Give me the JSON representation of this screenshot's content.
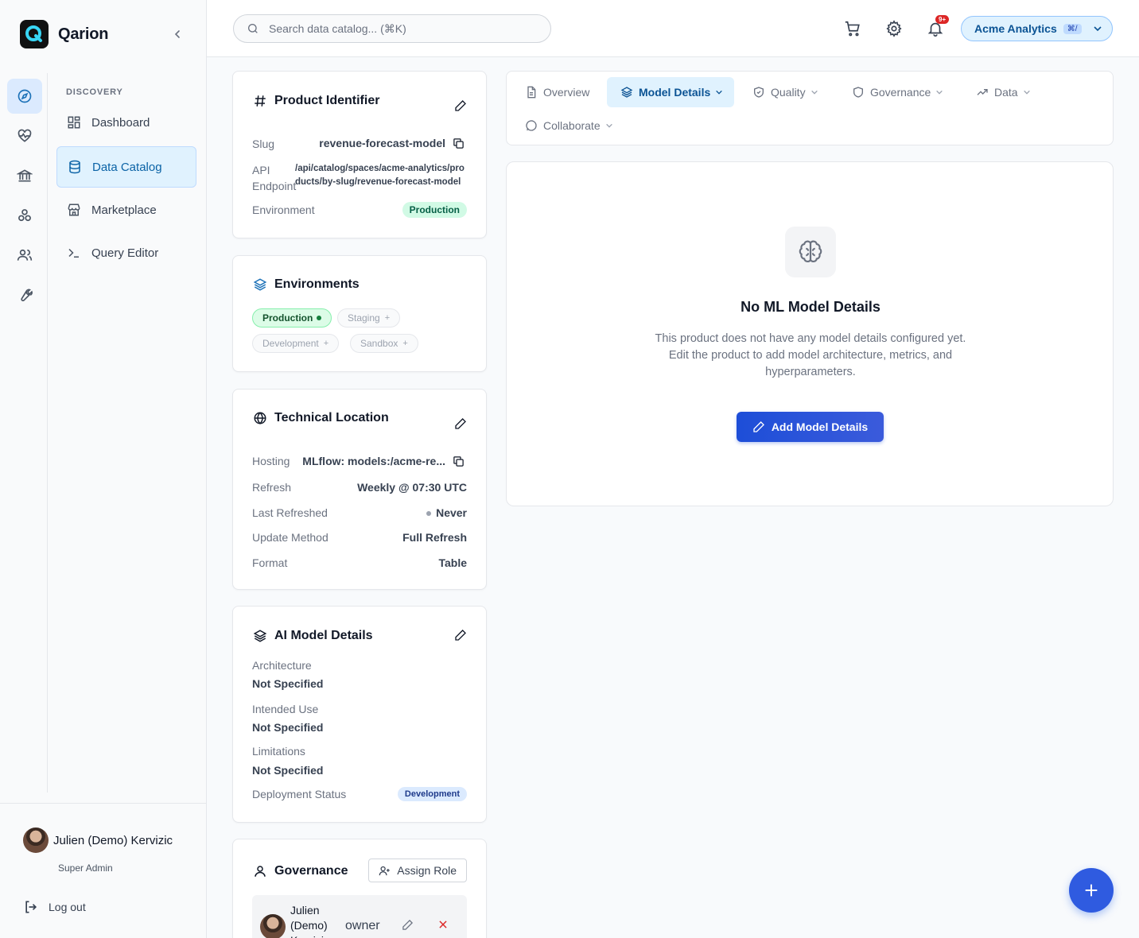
{
  "app": {
    "name": "Qarion"
  },
  "sidebar": {
    "section": "DISCOVERY",
    "rail_icons": [
      "compass-icon",
      "heartbeat-icon",
      "bank-icon",
      "network-icon",
      "users-icon",
      "wrench-icon"
    ],
    "items": [
      {
        "label": "Dashboard",
        "icon": "dashboard-icon",
        "active": false
      },
      {
        "label": "Data Catalog",
        "icon": "database-icon",
        "active": true
      },
      {
        "label": "Marketplace",
        "icon": "store-icon",
        "active": false
      },
      {
        "label": "Query Editor",
        "icon": "terminal-icon",
        "active": false
      }
    ],
    "user": {
      "name": "Julien (Demo) Kervizic",
      "role": "Super Admin"
    },
    "logout_label": "Log out"
  },
  "header": {
    "search_placeholder": "Search data catalog... (⌘K)",
    "notification_badge": "9+",
    "org": {
      "name": "Acme Analytics",
      "shortcut": "⌘/"
    }
  },
  "product_identifier": {
    "title": "Product Identifier",
    "slug_label": "Slug",
    "slug_value": "revenue-forecast-model",
    "api_label": "API Endpoint",
    "api_value": "/api/catalog/spaces/acme-analytics/products/by-slug/revenue-forecast-model",
    "env_label": "Environment",
    "env_value": "Production"
  },
  "environments": {
    "title": "Environments",
    "chips": [
      {
        "label": "Production",
        "active": true
      },
      {
        "label": "Staging",
        "active": false
      },
      {
        "label": "Development",
        "active": false
      },
      {
        "label": "Sandbox",
        "active": false
      }
    ]
  },
  "technical_location": {
    "title": "Technical Location",
    "rows": [
      {
        "label": "Hosting",
        "value": "MLflow: models:/acme-re..."
      },
      {
        "label": "Refresh",
        "value": "Weekly @ 07:30 UTC"
      },
      {
        "label": "Last Refreshed",
        "value": "Never"
      },
      {
        "label": "Update Method",
        "value": "Full Refresh"
      },
      {
        "label": "Format",
        "value": "Table"
      }
    ]
  },
  "ai_model": {
    "title": "AI Model Details",
    "architecture_label": "Architecture",
    "architecture_value": "Not Specified",
    "intended_label": "Intended Use",
    "intended_value": "Not Specified",
    "limitations_label": "Limitations",
    "limitations_value": "Not Specified",
    "deployment_label": "Deployment Status",
    "deployment_value": "Development"
  },
  "governance": {
    "title": "Governance",
    "assign_label": "Assign Role",
    "member": {
      "name": "Julien (Demo) Kervizic",
      "role": "owner"
    }
  },
  "tabs": [
    {
      "label": "Overview",
      "icon": "document-icon",
      "active": false,
      "dropdown": false
    },
    {
      "label": "Model Details",
      "icon": "layers-icon",
      "active": true,
      "dropdown": true
    },
    {
      "label": "Quality",
      "icon": "shield-check-icon",
      "active": false,
      "dropdown": true
    },
    {
      "label": "Governance",
      "icon": "shield-icon",
      "active": false,
      "dropdown": true
    },
    {
      "label": "Data",
      "icon": "trend-icon",
      "active": false,
      "dropdown": true
    },
    {
      "label": "Collaborate",
      "icon": "chat-icon",
      "active": false,
      "dropdown": true
    }
  ],
  "empty_state": {
    "title": "No ML Model Details",
    "text": "This product does not have any model details configured yet. Edit the product to add model architecture, metrics, and hyperparameters.",
    "button": "Add Model Details"
  },
  "colors": {
    "accent": "#1d4ed8",
    "active_nav": "#e0f2fe",
    "success": "#d1fae5"
  }
}
